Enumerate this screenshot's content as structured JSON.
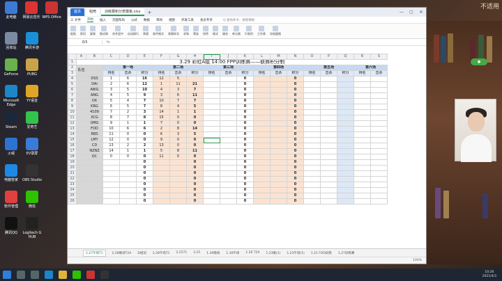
{
  "watermark": "不适用",
  "desktop": [
    {
      "label": "此电脑",
      "color": "#3b7bd6"
    },
    {
      "label": "网易云音乐",
      "color": "#d33"
    },
    {
      "label": "WPS Office",
      "color": "#c33"
    },
    {
      "label": "回收站",
      "color": "#7a8aa0"
    },
    {
      "label": "腾讯手游",
      "color": "#1a8fd8"
    },
    {
      "label": "GeForce",
      "color": "#6ab04c"
    },
    {
      "label": "PUBG",
      "color": "#c9a34a"
    },
    {
      "label": "Microsoft Edge",
      "color": "#1c86c7"
    },
    {
      "label": "YY语音",
      "color": "#e0a526"
    },
    {
      "label": "Steam",
      "color": "#1b2838"
    },
    {
      "label": "爱奇艺",
      "color": "#32c24d"
    },
    {
      "label": "火绒",
      "color": "#2c73d2"
    },
    {
      "label": "EV录屏",
      "color": "#3a7bd5"
    },
    {
      "label": "电脑管家",
      "color": "#1e88e5"
    },
    {
      "label": "OBS Studio",
      "color": "#333"
    },
    {
      "label": "软件管理",
      "color": "#e04040"
    },
    {
      "label": "微信",
      "color": "#2dc100"
    },
    {
      "label": "腾讯QQ",
      "color": "#111"
    },
    {
      "label": "Logitech G HUB",
      "color": "#222"
    }
  ],
  "window": {
    "tabs": [
      "首页",
      "稻壳",
      "训练赛积分表模板.xlsx"
    ],
    "menu": [
      "三 文件",
      "开始",
      "插入",
      "页面布局",
      "公式",
      "数据",
      "审阅",
      "视图",
      "开发工具",
      "会员专享",
      "Q 查找命令、搜索模板"
    ],
    "ribbon": [
      "粘贴",
      "剪切",
      "复制",
      "格式刷",
      "合并居中",
      "自动换行",
      "常规",
      "条件格式",
      "表格样式",
      "求和",
      "筛选",
      "排序",
      "格式",
      "填充",
      "单元格",
      "行和列",
      "工作表",
      "冻结窗格"
    ],
    "namebox": "I15",
    "fx": "fx"
  },
  "sheet": {
    "title": "3.29  彩虹A组 14:00 FPP训练赛——联赛积分制",
    "columns": [
      "A",
      "B",
      "C",
      "D",
      "E",
      "F",
      "G",
      "H",
      "I",
      "J",
      "K",
      "L",
      "M",
      "N",
      "O",
      "P",
      "Q",
      "R",
      "S"
    ],
    "team_header": "队伍",
    "games": [
      "第一场",
      "第二场",
      "第三场",
      "第四场",
      "第五场",
      "第六场"
    ],
    "sub_headers": [
      "排名",
      "击杀",
      "积分"
    ],
    "rows": [
      {
        "n": "4",
        "team": "DSS",
        "g1": [
          "1",
          "6",
          "16"
        ],
        "g2": [
          "12",
          "5"
        ],
        "g3": "0",
        "g4": "0"
      },
      {
        "n": "5",
        "team": "DAI",
        "g1": [
          "2",
          "6",
          "12"
        ],
        "g2": [
          "1",
          "11",
          "21"
        ],
        "g3": "0",
        "g4": "0"
      },
      {
        "n": "6",
        "team": "AWG",
        "g1": [
          "3",
          "5",
          "10"
        ],
        "g2": [
          "4",
          "3",
          "7"
        ],
        "g3": "0",
        "g4": "0"
      },
      {
        "n": "7",
        "team": "ANG",
        "g1": [
          "4",
          "5",
          "9"
        ],
        "g2": [
          "3",
          "6",
          "11"
        ],
        "g3": "0",
        "g4": "0"
      },
      {
        "n": "8",
        "team": "OX",
        "g1": [
          "5",
          "4",
          "7"
        ],
        "g2": [
          "10",
          "7",
          "7"
        ],
        "g3": "0",
        "g4": "0"
      },
      {
        "n": "9",
        "team": "KRG",
        "g1": [
          "6",
          "5",
          "7"
        ],
        "g2": [
          "8",
          "4",
          "5"
        ],
        "g3": "0",
        "g4": "0"
      },
      {
        "n": "10",
        "team": "4109",
        "g1": [
          "7",
          "2",
          "3"
        ],
        "g2": [
          "14",
          "1",
          "1"
        ],
        "g3": "0",
        "g4": "0"
      },
      {
        "n": "11",
        "team": "XCG",
        "g1": [
          "8",
          "7",
          "8"
        ],
        "g2": [
          "15",
          "0",
          "0"
        ],
        "g3": "0",
        "g4": "0"
      },
      {
        "n": "12",
        "team": "UMG",
        "g1": [
          "9",
          "1",
          "1"
        ],
        "g2": [
          "7",
          "0",
          "0"
        ],
        "g3": "0",
        "g4": "0"
      },
      {
        "n": "13",
        "team": "FOD",
        "g1": [
          "10",
          "6",
          "6"
        ],
        "g2": [
          "2",
          "8",
          "14"
        ],
        "g3": "0",
        "g4": "0"
      },
      {
        "n": "14",
        "team": "RBS",
        "g1": [
          "11",
          "0",
          "0"
        ],
        "g2": [
          "6",
          "3",
          "5"
        ],
        "g3": "0",
        "g4": "0"
      },
      {
        "n": "15",
        "team": "LMY",
        "g1": [
          "12",
          "0",
          "0"
        ],
        "g2": [
          "9",
          "0",
          "0"
        ],
        "g3": "0",
        "g4": "0"
      },
      {
        "n": "16",
        "team": "CD",
        "g1": [
          "13",
          "2",
          "2"
        ],
        "g2": [
          "13",
          "0",
          "0"
        ],
        "g3": "0",
        "g4": "0"
      },
      {
        "n": "17",
        "team": "NZNZ",
        "g1": [
          "14",
          "1",
          "1"
        ],
        "g2": [
          "5",
          "8",
          "11"
        ],
        "g3": "0",
        "g4": "0"
      },
      {
        "n": "18",
        "team": "QC",
        "g1": [
          "0",
          "0",
          "0"
        ],
        "g2": [
          "11",
          "0",
          "0"
        ],
        "g3": "0",
        "g4": "0"
      },
      {
        "n": "19",
        "team": "",
        "g1": [
          "",
          "",
          "0"
        ],
        "g2": [
          "",
          "",
          "0"
        ],
        "g3": "0",
        "g4": "0"
      },
      {
        "n": "20",
        "team": "",
        "g1": [
          "",
          "",
          "0"
        ],
        "g2": [
          "",
          "",
          "0"
        ],
        "g3": "0",
        "g4": "0"
      },
      {
        "n": "21",
        "team": "",
        "g1": [
          "",
          "",
          "0"
        ],
        "g2": [
          "",
          "",
          "0"
        ],
        "g3": "0",
        "g4": "0"
      },
      {
        "n": "22",
        "team": "",
        "g1": [
          "",
          "",
          "0"
        ],
        "g2": [
          "",
          "",
          "0"
        ],
        "g3": "0",
        "g4": "0"
      },
      {
        "n": "23",
        "team": "",
        "g1": [
          "",
          "",
          "0"
        ],
        "g2": [
          "",
          "",
          "0"
        ],
        "g3": "0",
        "g4": "0"
      },
      {
        "n": "24",
        "team": "",
        "g1": [
          "",
          "",
          "0"
        ],
        "g2": [
          "",
          "",
          "0"
        ],
        "g3": "0",
        "g4": "0"
      },
      {
        "n": "25",
        "team": "",
        "g1": [
          "",
          "",
          "0"
        ],
        "g2": [
          "",
          "",
          "0"
        ],
        "g3": "0",
        "g4": "0"
      },
      {
        "n": "26",
        "team": "",
        "g1": [
          "",
          "",
          "0"
        ],
        "g2": [
          "",
          "",
          "0"
        ],
        "g3": "0",
        "g4": "0"
      }
    ],
    "sheet_tabs": [
      "2.27午场T1",
      "2.28晚场T2A",
      "D组训",
      "2.28午场T1",
      "2.2571",
      "3.25",
      "1.30晚场",
      "1.30午场",
      "1.26 T2A",
      "1.23晚(1)",
      "1.23午场(1)",
      "1.21 FOD训练",
      "1.27训练赛"
    ],
    "status_text": "",
    "zoom": "100%"
  },
  "taskbar": {
    "time": "10:26",
    "date": "2021/4/3"
  },
  "colors": {
    "team_bg": "#d7d7d7",
    "orange_band": "#fbe3d2",
    "blue_band": "#dde8f6",
    "group_header": "#c7d9f1",
    "accent": "#1e9e5a"
  }
}
